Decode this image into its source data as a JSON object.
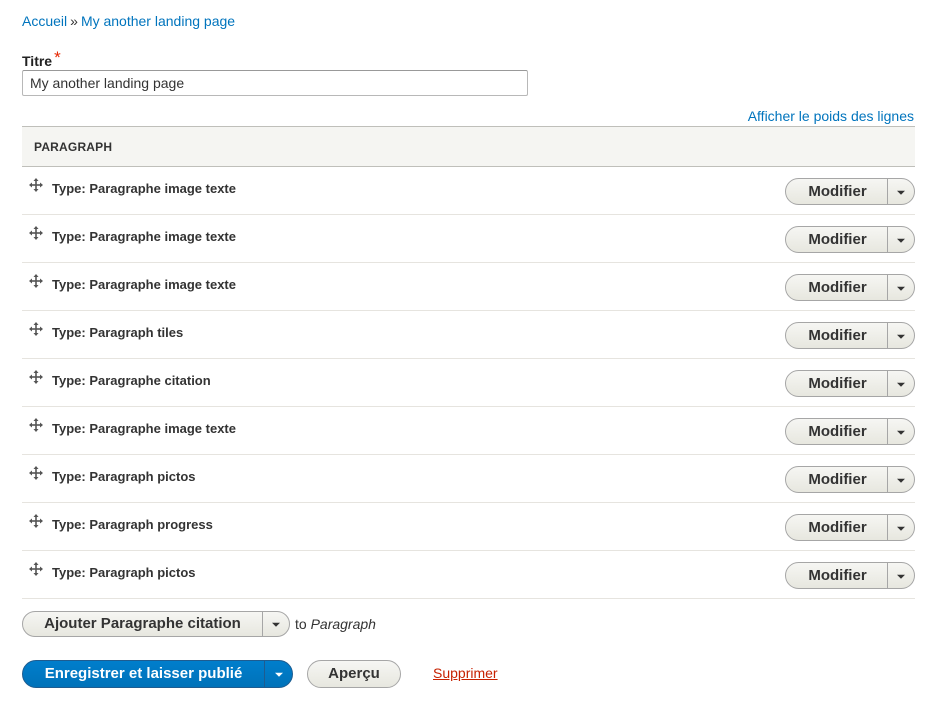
{
  "breadcrumb": {
    "items": [
      "Accueil",
      "My another landing page"
    ],
    "separator": "»"
  },
  "title_field": {
    "label": "Titre",
    "required_mark": "*",
    "value": "My another landing page"
  },
  "weight_toggle_label": "Afficher le poids des lignes",
  "table": {
    "header": "PARAGRAPH",
    "rows": [
      {
        "type": "Type: Paragraphe image texte",
        "action": "Modifier"
      },
      {
        "type": "Type: Paragraphe image texte",
        "action": "Modifier"
      },
      {
        "type": "Type: Paragraphe image texte",
        "action": "Modifier"
      },
      {
        "type": "Type: Paragraph tiles",
        "action": "Modifier"
      },
      {
        "type": "Type: Paragraphe citation",
        "action": "Modifier"
      },
      {
        "type": "Type: Paragraphe image texte",
        "action": "Modifier"
      },
      {
        "type": "Type: Paragraph pictos",
        "action": "Modifier"
      },
      {
        "type": "Type: Paragraph progress",
        "action": "Modifier"
      },
      {
        "type": "Type: Paragraph pictos",
        "action": "Modifier"
      }
    ]
  },
  "add_paragraph": {
    "label": "Ajouter Paragraphe citation",
    "suffix_prefix": "to",
    "suffix_target": "Paragraph"
  },
  "actions": {
    "save_label": "Enregistrer et laisser publié",
    "preview_label": "Aperçu",
    "delete_label": "Supprimer"
  },
  "colors": {
    "link": "#0074bd",
    "primary_button": "#0074bd",
    "danger_link": "#c72100",
    "required": "#e62600"
  }
}
